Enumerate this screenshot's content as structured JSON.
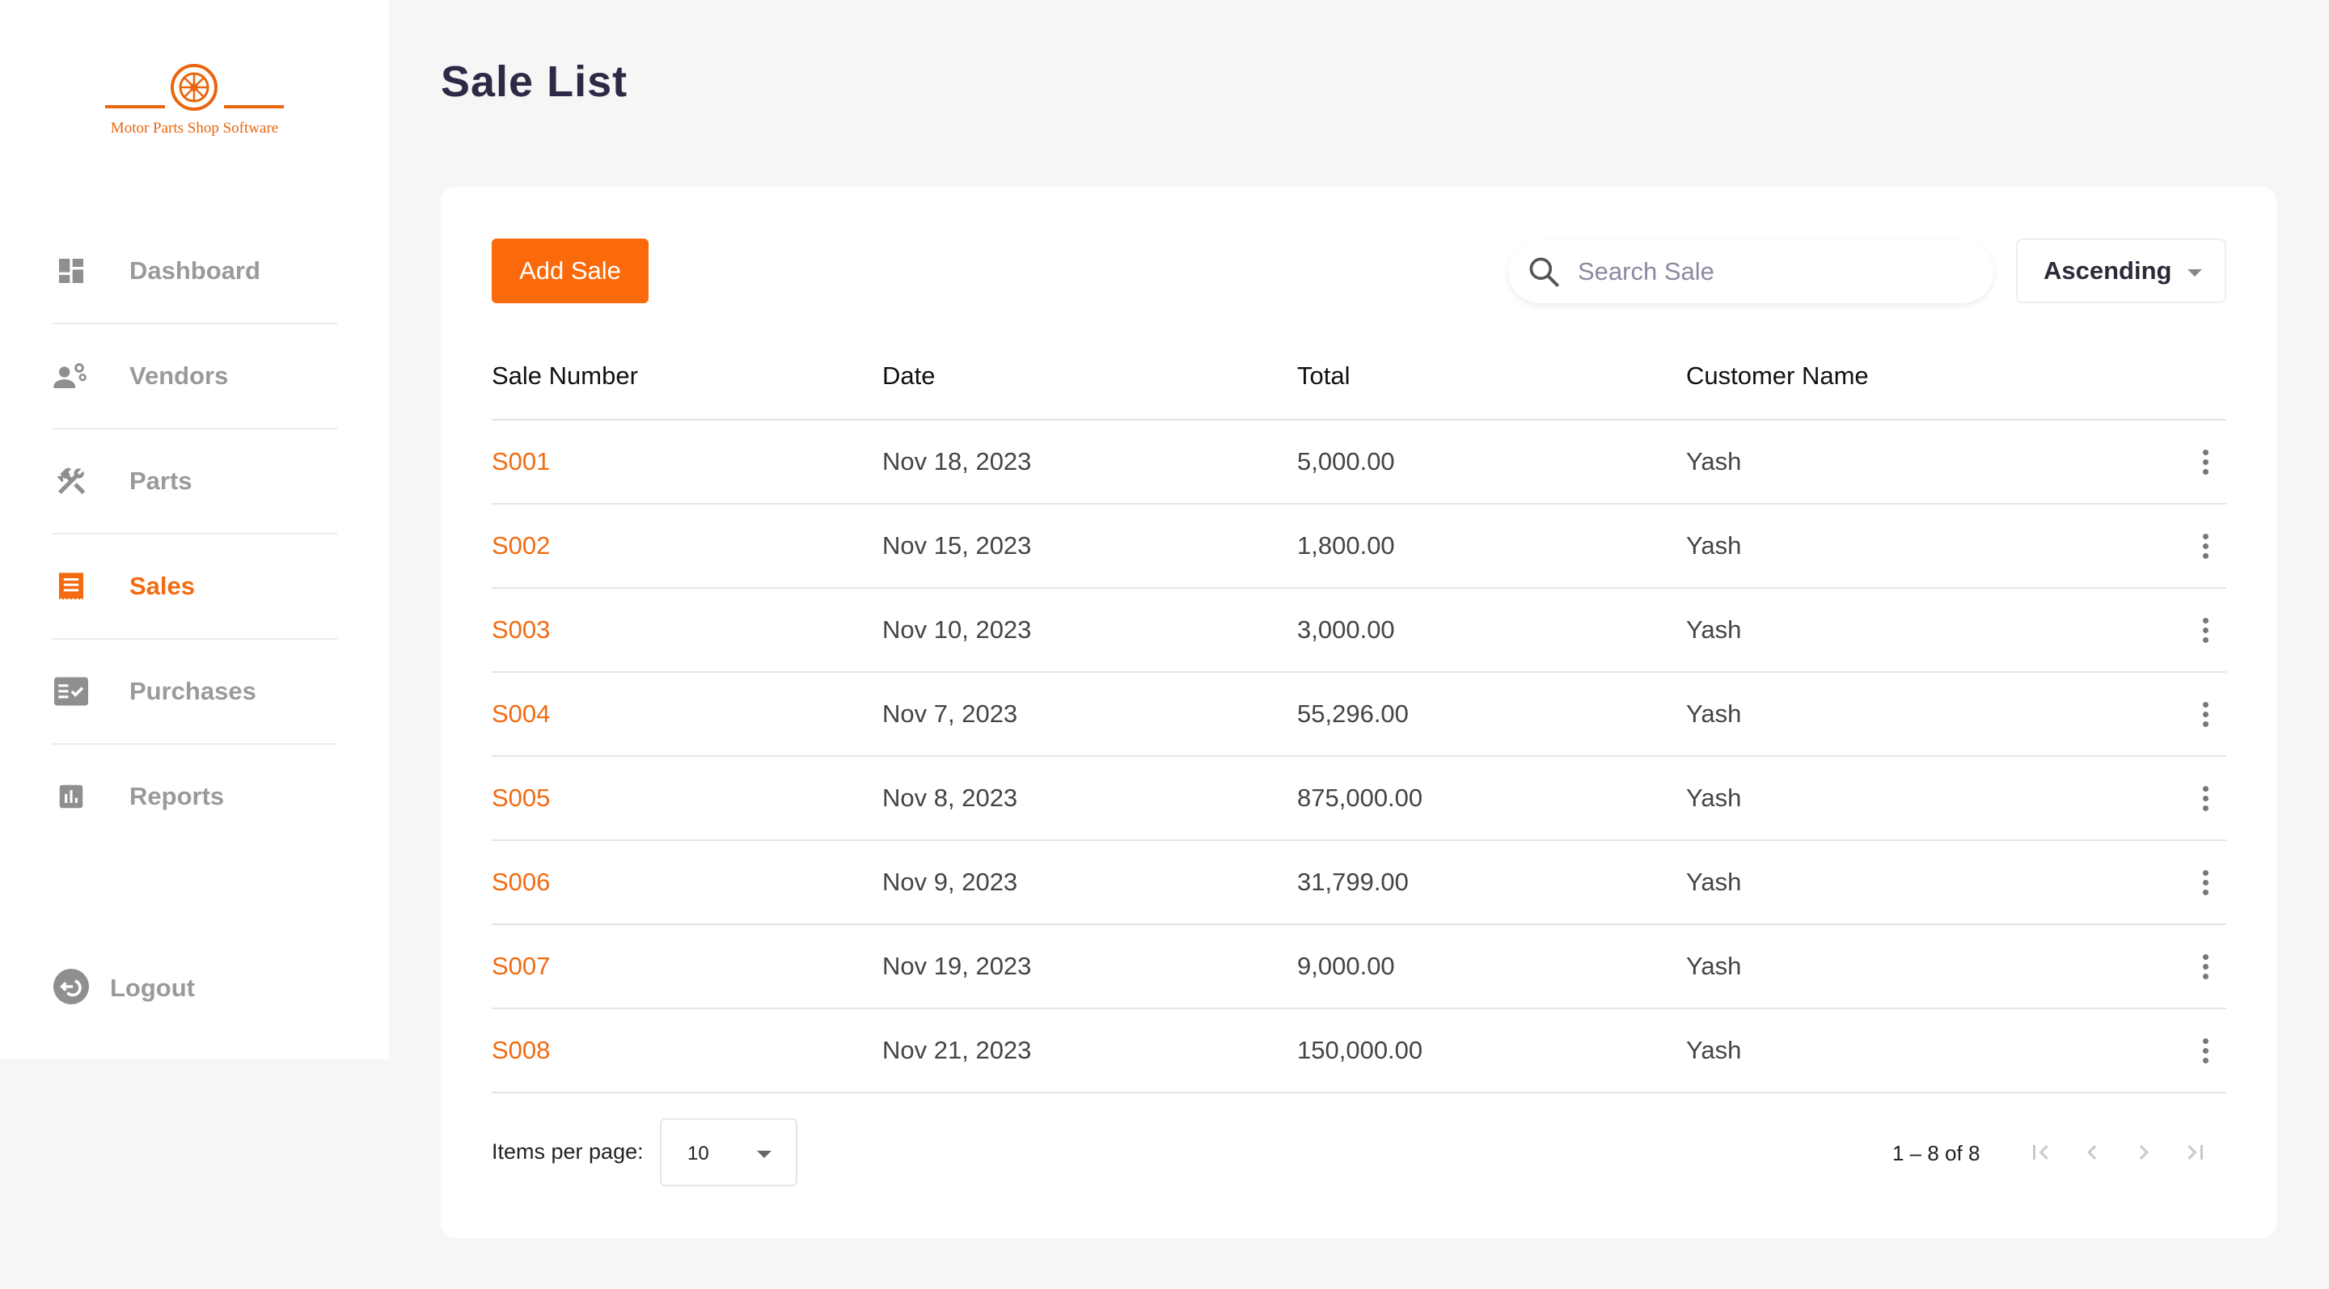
{
  "app": {
    "logo_text": "Motor Parts Shop Software",
    "accent_color": "#f26b10"
  },
  "sidebar": {
    "items": [
      {
        "label": "Dashboard",
        "icon": "dashboard-icon",
        "active": false
      },
      {
        "label": "Vendors",
        "icon": "vendors-icon",
        "active": false
      },
      {
        "label": "Parts",
        "icon": "tools-icon",
        "active": false
      },
      {
        "label": "Sales",
        "icon": "receipt-icon",
        "active": true
      },
      {
        "label": "Purchases",
        "icon": "checklist-icon",
        "active": false
      },
      {
        "label": "Reports",
        "icon": "bar-chart-icon",
        "active": false
      }
    ],
    "logout_label": "Logout"
  },
  "page": {
    "title": "Sale List"
  },
  "toolbar": {
    "add_label": "Add Sale",
    "search_placeholder": "Search Sale",
    "sort_value": "Ascending"
  },
  "table": {
    "headers": [
      "Sale Number",
      "Date",
      "Total",
      "Customer Name"
    ],
    "rows": [
      {
        "number": "S001",
        "date": "Nov 18, 2023",
        "total": "5,000.00",
        "customer": "Yash"
      },
      {
        "number": "S002",
        "date": "Nov 15, 2023",
        "total": "1,800.00",
        "customer": "Yash"
      },
      {
        "number": "S003",
        "date": "Nov 10, 2023",
        "total": "3,000.00",
        "customer": "Yash"
      },
      {
        "number": "S004",
        "date": "Nov 7, 2023",
        "total": "55,296.00",
        "customer": "Yash"
      },
      {
        "number": "S005",
        "date": "Nov 8, 2023",
        "total": "875,000.00",
        "customer": "Yash"
      },
      {
        "number": "S006",
        "date": "Nov 9, 2023",
        "total": "31,799.00",
        "customer": "Yash"
      },
      {
        "number": "S007",
        "date": "Nov 19, 2023",
        "total": "9,000.00",
        "customer": "Yash"
      },
      {
        "number": "S008",
        "date": "Nov 21, 2023",
        "total": "150,000.00",
        "customer": "Yash"
      }
    ]
  },
  "paginator": {
    "items_per_page_label": "Items per page:",
    "items_per_page_value": "10",
    "range_label": "1 – 8 of 8"
  }
}
